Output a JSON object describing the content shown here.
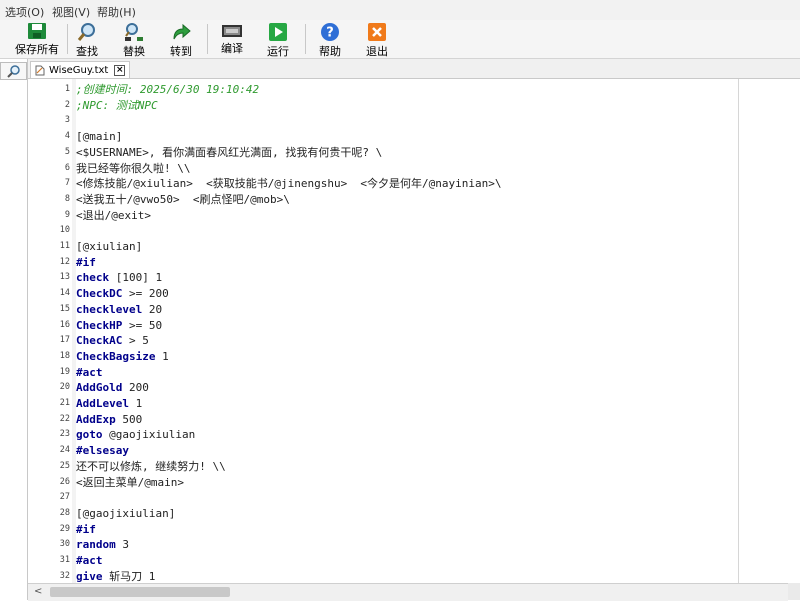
{
  "menu": [
    "选项(O)",
    "视图(V)",
    "帮助(H)"
  ],
  "toolbar": {
    "save_all": "保存所有",
    "find": "查找",
    "replace": "替换",
    "goto": "转到",
    "compile": "编译",
    "run": "运行",
    "help": "帮助",
    "exit": "退出"
  },
  "tab": {
    "filename": "WiseGuy.txt"
  },
  "lines": [
    {
      "n": "1",
      "t": ";创建时间: 2025/6/30 19:10:42",
      "s": "comment"
    },
    {
      "n": "2",
      "t": ";NPC: 测试NPC",
      "s": "comment"
    },
    {
      "n": "3",
      "t": "",
      "s": "plain"
    },
    {
      "n": "4",
      "t": "[@main]",
      "s": "plain"
    },
    {
      "n": "5",
      "t": "<$USERNAME>, 看你满面春风红光满面, 找我有何贵干呢? \\",
      "s": "plain"
    },
    {
      "n": "6",
      "t": "我已经等你很久啦! \\\\",
      "s": "plain"
    },
    {
      "n": "7",
      "t": "<修炼技能/@xiulian>  <获取技能书/@jinengshu>  <今夕是何年/@nayinian>\\",
      "s": "plain"
    },
    {
      "n": "8",
      "t": "<送我五十/@vwo50>  <刷点怪吧/@mob>\\",
      "s": "plain"
    },
    {
      "n": "9",
      "t": "<退出/@exit>",
      "s": "plain"
    },
    {
      "n": "10",
      "t": "",
      "s": "plain"
    },
    {
      "n": "11",
      "t": "[@xiulian]",
      "s": "plain"
    },
    {
      "n": "12",
      "t": "#if",
      "s": "kw"
    },
    {
      "n": "13",
      "t": "check [100] 1",
      "s": "kwline",
      "k": "check",
      "r": " [100] 1"
    },
    {
      "n": "14",
      "t": "CheckDC >= 200",
      "s": "kwline",
      "k": "CheckDC",
      "r": " >= 200"
    },
    {
      "n": "15",
      "t": "checklevel 20",
      "s": "kwline",
      "k": "checklevel",
      "r": " 20"
    },
    {
      "n": "16",
      "t": "CheckHP >= 50",
      "s": "kwline",
      "k": "CheckHP",
      "r": " >= 50"
    },
    {
      "n": "17",
      "t": "CheckAC > 5",
      "s": "kwline",
      "k": "CheckAC",
      "r": " > 5"
    },
    {
      "n": "18",
      "t": "CheckBagsize 1",
      "s": "kwline",
      "k": "CheckBagsize",
      "r": " 1"
    },
    {
      "n": "19",
      "t": "#act",
      "s": "kw"
    },
    {
      "n": "20",
      "t": "AddGold 200",
      "s": "kwline",
      "k": "AddGold",
      "r": " 200"
    },
    {
      "n": "21",
      "t": "AddLevel 1",
      "s": "kwline",
      "k": "AddLevel",
      "r": " 1"
    },
    {
      "n": "22",
      "t": "AddExp 500",
      "s": "kwline",
      "k": "AddExp",
      "r": " 500"
    },
    {
      "n": "23",
      "t": "goto @gaojixiulian",
      "s": "kwline",
      "k": "goto",
      "r": " @gaojixiulian"
    },
    {
      "n": "24",
      "t": "#elsesay",
      "s": "kw"
    },
    {
      "n": "25",
      "t": "还不可以修炼, 继续努力! \\\\",
      "s": "plain"
    },
    {
      "n": "26",
      "t": "<返回主菜单/@main>",
      "s": "plain"
    },
    {
      "n": "27",
      "t": "",
      "s": "plain"
    },
    {
      "n": "28",
      "t": "[@gaojixiulian]",
      "s": "plain"
    },
    {
      "n": "29",
      "t": "#if",
      "s": "kw"
    },
    {
      "n": "30",
      "t": "random 3",
      "s": "kwline",
      "k": "random",
      "r": " 3"
    },
    {
      "n": "31",
      "t": "#act",
      "s": "kw"
    },
    {
      "n": "32",
      "t": "give 斩马刀 1",
      "s": "kwline",
      "k": "give",
      "r": " 斩马刀 1"
    }
  ],
  "colors": {
    "comment": "#2f9a2f",
    "keyword": "#00008b",
    "text": "#222222"
  },
  "icons": [
    "save-icon",
    "find-icon",
    "replace-icon",
    "goto-arrow-icon",
    "compile-icon",
    "run-icon",
    "help-icon",
    "exit-icon"
  ]
}
